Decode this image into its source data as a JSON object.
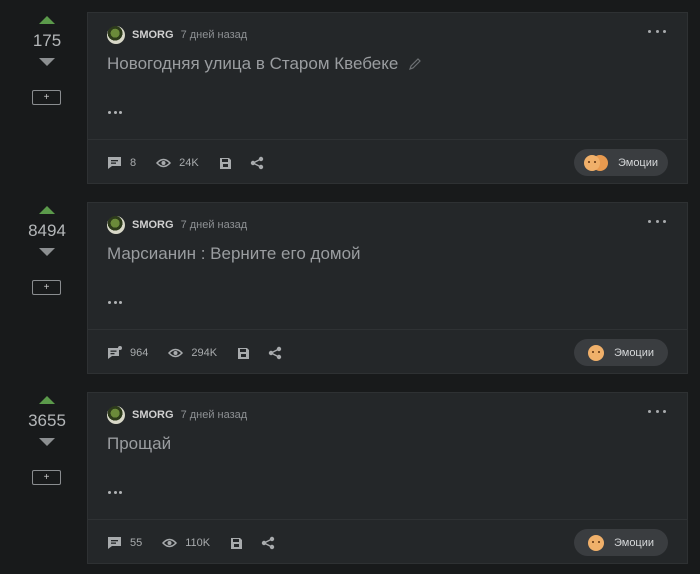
{
  "posts": [
    {
      "score": "175",
      "add_label": "+",
      "author": "SMORG",
      "time": "7 дней назад",
      "title": "Новогодняя улица в Старом Квебеке",
      "has_edit_icon": true,
      "comments": "8",
      "views": "24K",
      "emotions_label": "Эмоции",
      "emotions_icon": "double-emoji-icon"
    },
    {
      "score": "8494",
      "add_label": "+",
      "author": "SMORG",
      "time": "7 дней назад",
      "title": "Марсианин : Верните его домой",
      "has_edit_icon": false,
      "comments": "964",
      "views": "294K",
      "emotions_label": "Эмоции",
      "emotions_icon": "emoji-icon"
    },
    {
      "score": "3655",
      "add_label": "+",
      "author": "SMORG",
      "time": "7 дней назад",
      "title": "Прощай",
      "has_edit_icon": false,
      "comments": "55",
      "views": "110K",
      "emotions_label": "Эмоции",
      "emotions_icon": "emoji-icon"
    }
  ],
  "colors": {
    "background": "#181a1b",
    "card": "#242729",
    "upvote": "#5b9a4b",
    "downvote": "#8c8f91",
    "emotions_button": "#3a3d40"
  }
}
